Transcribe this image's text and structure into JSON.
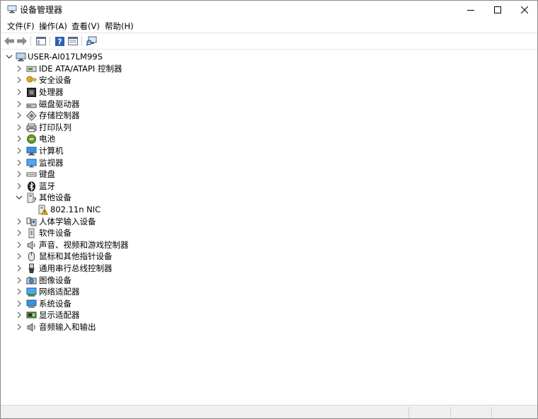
{
  "window": {
    "title": "设备管理器"
  },
  "menu": [
    "文件(F)",
    "操作(A)",
    "查看(V)",
    "帮助(H)"
  ],
  "toolbar": {
    "icons": [
      "back-arrow-icon",
      "forward-arrow-icon",
      "console-tree-icon",
      "help-icon",
      "properties-icon",
      "scan-hardware-icon"
    ]
  },
  "tree": {
    "root": "USER-AI017LM99S",
    "categories": [
      {
        "label": "IDE ATA/ATAPI 控制器",
        "icon": "ide-controller-icon"
      },
      {
        "label": "安全设备",
        "icon": "security-key-icon"
      },
      {
        "label": "处理器",
        "icon": "processor-icon"
      },
      {
        "label": "磁盘驱动器",
        "icon": "disk-drive-icon"
      },
      {
        "label": "存储控制器",
        "icon": "storage-controller-icon"
      },
      {
        "label": "打印队列",
        "icon": "printer-icon"
      },
      {
        "label": "电池",
        "icon": "battery-icon"
      },
      {
        "label": "计算机",
        "icon": "computer-icon"
      },
      {
        "label": "监视器",
        "icon": "monitor-icon"
      },
      {
        "label": "键盘",
        "icon": "keyboard-icon"
      },
      {
        "label": "蓝牙",
        "icon": "bluetooth-icon"
      },
      {
        "label": "其他设备",
        "icon": "other-devices-icon",
        "expanded": true,
        "children": [
          {
            "label": "802.11n NIC",
            "icon": "warning-device-icon"
          }
        ]
      },
      {
        "label": "人体学输入设备",
        "icon": "hid-icon"
      },
      {
        "label": "软件设备",
        "icon": "software-device-icon"
      },
      {
        "label": "声音、视频和游戏控制器",
        "icon": "speaker-icon"
      },
      {
        "label": "鼠标和其他指针设备",
        "icon": "mouse-icon"
      },
      {
        "label": "通用串行总线控制器",
        "icon": "usb-icon"
      },
      {
        "label": "图像设备",
        "icon": "camera-icon"
      },
      {
        "label": "网络适配器",
        "icon": "network-adapter-icon"
      },
      {
        "label": "系统设备",
        "icon": "system-device-icon"
      },
      {
        "label": "显示适配器",
        "icon": "display-adapter-icon"
      },
      {
        "label": "音频输入和输出",
        "icon": "audio-io-icon"
      }
    ]
  }
}
